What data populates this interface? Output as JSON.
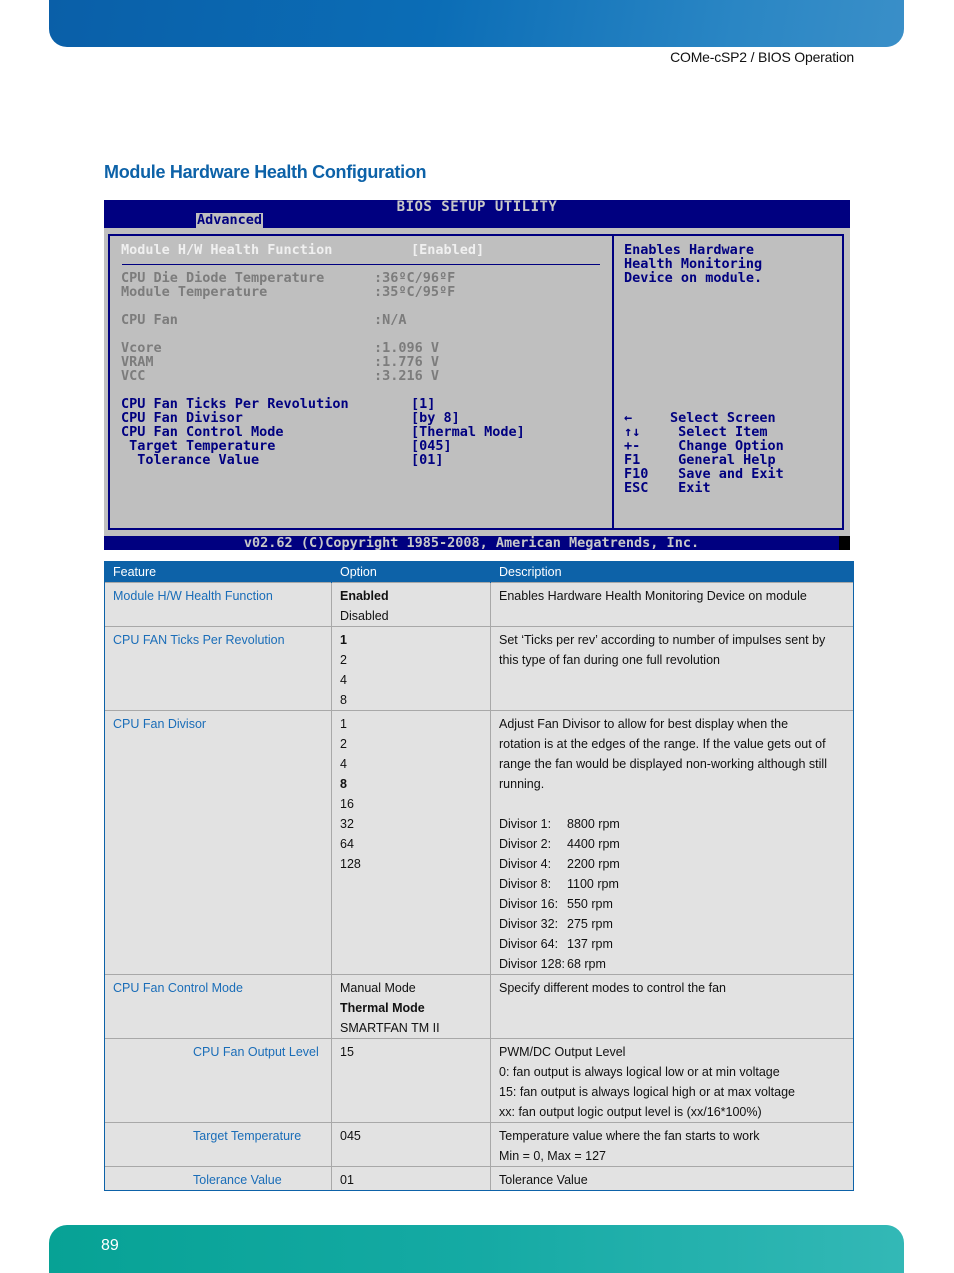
{
  "header": {
    "doc_section": "COMe-cSP2 / BIOS Operation"
  },
  "section_title": "Module Hardware Health Configuration",
  "bios": {
    "title": "BIOS SETUP UTILITY",
    "active_tab": "Advanced",
    "selected_item": {
      "label": "Module H/W Health Function",
      "value": "[Enabled]"
    },
    "readings": [
      {
        "label": "CPU Die Diode Temperature",
        "value": ":36ºC/96ºF"
      },
      {
        "label": "Module Temperature",
        "value": ":35ºC/95ºF"
      },
      {
        "label": "CPU Fan",
        "value": ":N/A"
      },
      {
        "label": "Vcore",
        "value": ":1.096 V"
      },
      {
        "label": "VRAM",
        "value": ":1.776 V"
      },
      {
        "label": "VCC",
        "value": ":3.216 V"
      }
    ],
    "settings": [
      {
        "label": "CPU Fan Ticks Per Revolution",
        "value": "[1]"
      },
      {
        "label": "CPU Fan Divisor",
        "value": "[by 8]"
      },
      {
        "label": "CPU Fan Control Mode",
        "value": "[Thermal Mode]"
      },
      {
        "label": " Target Temperature",
        "value": "[045]"
      },
      {
        "label": "  Tolerance Value",
        "value": "[01]"
      }
    ],
    "help_text": [
      "Enables Hardware",
      "Health Monitoring",
      "Device on module."
    ],
    "key_help": [
      {
        "key": "←",
        "action": "Select Screen"
      },
      {
        "key": "↑↓",
        "action": " Select Item"
      },
      {
        "key": "+-",
        "action": " Change Option"
      },
      {
        "key": "F1",
        "action": " General Help"
      },
      {
        "key": "F10",
        "action": " Save and Exit"
      },
      {
        "key": "ESC",
        "action": " Exit"
      }
    ],
    "footer": "v02.62 (C)Copyright 1985-2008, American Megatrends, Inc."
  },
  "table": {
    "headers": {
      "feature": "Feature",
      "option": "Option",
      "description": "Description"
    },
    "rows": [
      {
        "feature": "Module H/W Health Function",
        "options": [
          {
            "label": "Enabled",
            "default": true
          },
          {
            "label": "Disabled",
            "default": false
          }
        ],
        "description": [
          "Enables Hardware Health Monitoring Device on module"
        ]
      },
      {
        "feature": "CPU FAN Ticks Per Revolution",
        "options": [
          {
            "label": "1",
            "default": true
          },
          {
            "label": "2"
          },
          {
            "label": "4"
          },
          {
            "label": "8"
          }
        ],
        "description": [
          "Set ‘Ticks per rev’ according to number of impulses sent by",
          "this type of fan during one full revolution"
        ]
      },
      {
        "feature": "CPU Fan Divisor",
        "options": [
          {
            "label": "1"
          },
          {
            "label": "2"
          },
          {
            "label": "4"
          },
          {
            "label": "8",
            "default": true
          },
          {
            "label": "16"
          },
          {
            "label": "32"
          },
          {
            "label": "64"
          },
          {
            "label": "128"
          }
        ],
        "description": [
          "Adjust Fan Divisor to allow for best display when the",
          "rotation is at the edges of the range. If the value gets out of",
          "range the fan would be displayed non-working although still",
          "running.",
          ""
        ],
        "rpm_table": [
          {
            "divisor": "Divisor 1:",
            "rpm": "8800 rpm"
          },
          {
            "divisor": "Divisor 2:",
            "rpm": "4400 rpm"
          },
          {
            "divisor": "Divisor 4:",
            "rpm": "2200 rpm"
          },
          {
            "divisor": "Divisor 8:",
            "rpm": "1100 rpm"
          },
          {
            "divisor": "Divisor 16:",
            "rpm": "550 rpm"
          },
          {
            "divisor": "Divisor 32:",
            "rpm": "275 rpm"
          },
          {
            "divisor": "Divisor 64:",
            "rpm": "137 rpm"
          },
          {
            "divisor": "Divisor 128:",
            "rpm": "68 rpm"
          }
        ]
      },
      {
        "feature": "CPU Fan Control Mode",
        "options": [
          {
            "label": "Manual Mode"
          },
          {
            "label": "Thermal Mode",
            "default": true
          },
          {
            "label": "SMARTFAN TM II"
          }
        ],
        "description": [
          "Specify different modes to control the fan"
        ]
      },
      {
        "feature": "CPU Fan Output Level",
        "sub": true,
        "options": [
          {
            "label": "15"
          }
        ],
        "description": [
          "PWM/DC Output Level",
          "0: fan output is always logical low or at min voltage",
          "15: fan output is always logical high or at max voltage",
          "xx: fan output logic output level is (xx/16*100%)"
        ]
      },
      {
        "feature": "Target Temperature",
        "sub": true,
        "options": [
          {
            "label": "045"
          }
        ],
        "description": [
          "Temperature value where the fan starts to work",
          "Min = 0, Max = 127"
        ]
      },
      {
        "feature": "Tolerance Value",
        "sub": true,
        "options": [
          {
            "label": "01"
          }
        ],
        "description": [
          "Tolerance Value"
        ]
      }
    ]
  },
  "footer": {
    "page_number": "89"
  }
}
